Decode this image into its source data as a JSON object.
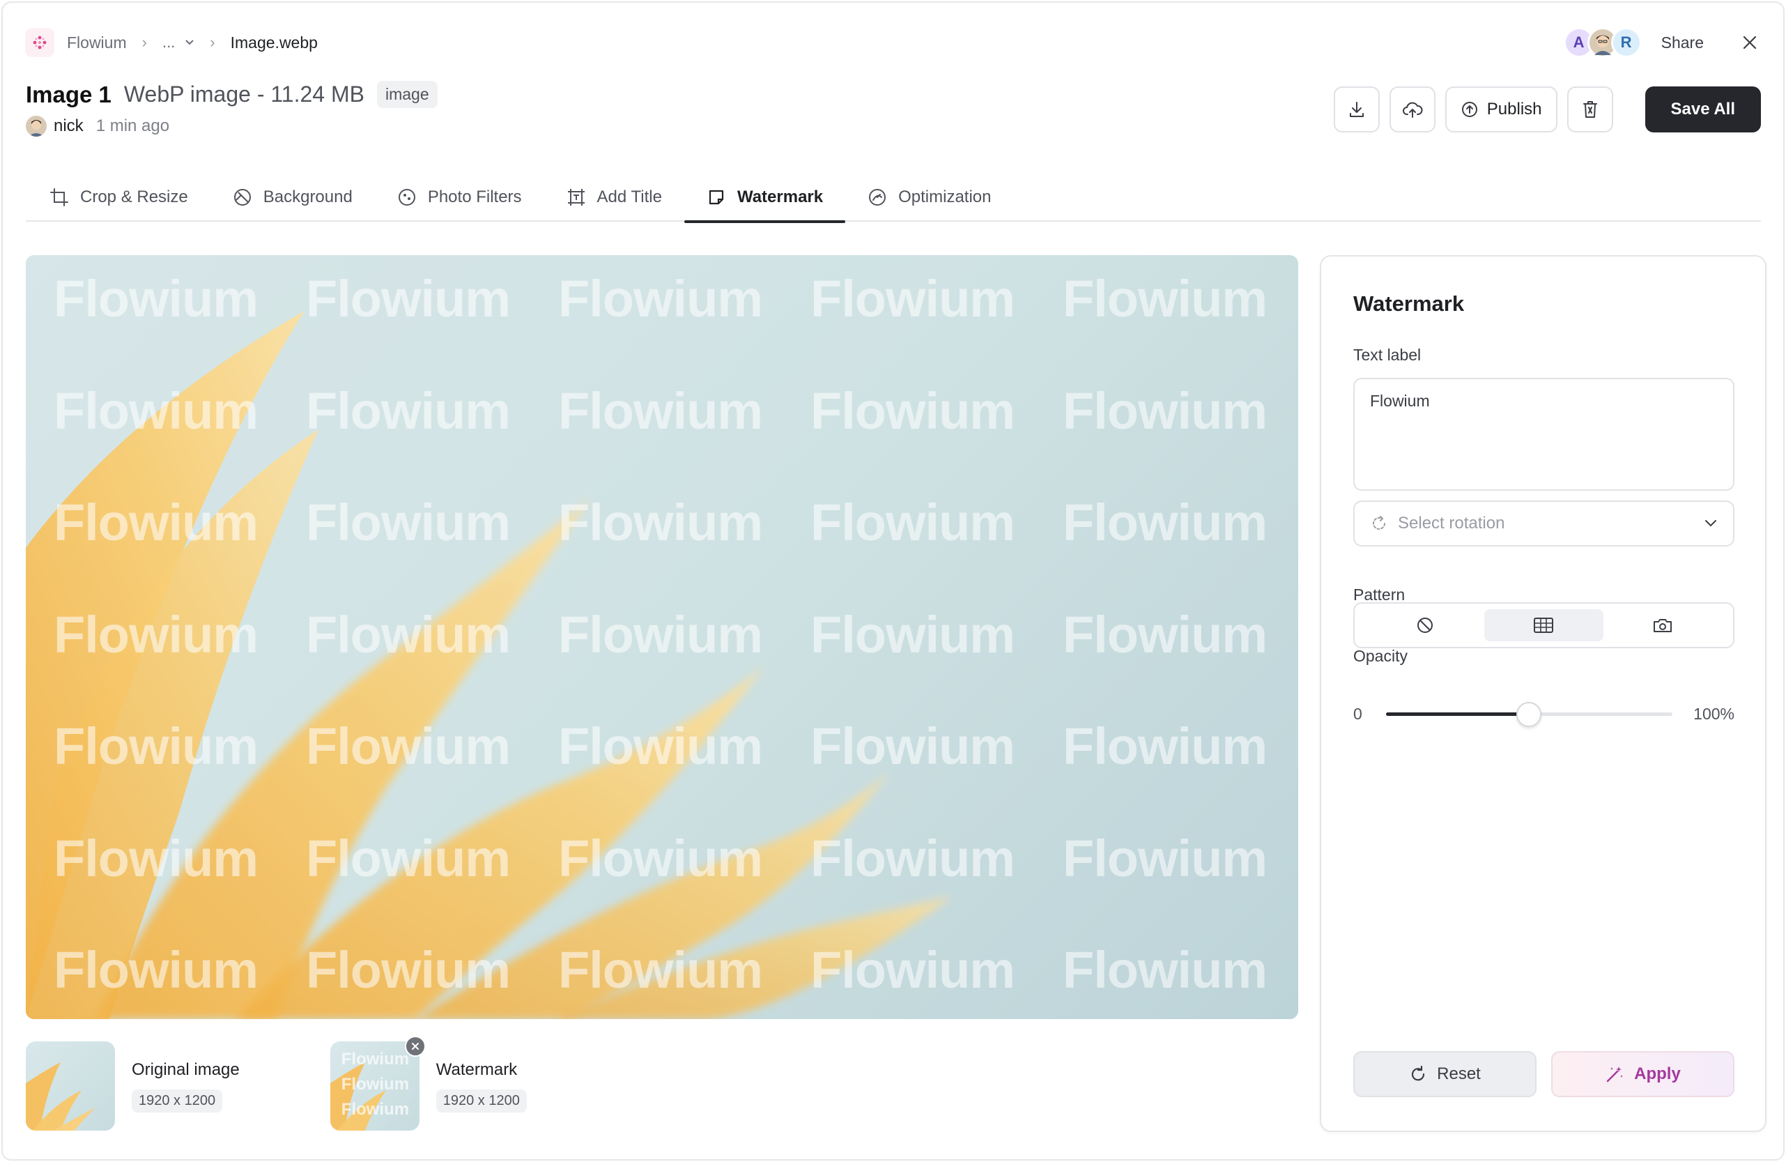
{
  "breadcrumb": {
    "app": "Flowium",
    "ellipsis": "...",
    "file": "Image.webp"
  },
  "header": {
    "avatars": [
      {
        "label": "A",
        "color": "#e6dcfb"
      },
      {
        "label": "",
        "color": "#d8c9b4"
      },
      {
        "label": "R",
        "color": "#dbeefb"
      }
    ],
    "share_label": "Share"
  },
  "file": {
    "title": "Image 1",
    "subtitle": "WebP image - 11.24 MB",
    "tag": "image",
    "user": "nick",
    "time": "1 min ago"
  },
  "actions": {
    "publish_label": "Publish",
    "save_all_label": "Save All"
  },
  "tabs": [
    {
      "label": "Crop & Resize",
      "icon": "crop-icon",
      "active": false
    },
    {
      "label": "Background",
      "icon": "background-icon",
      "active": false
    },
    {
      "label": "Photo Filters",
      "icon": "filter-icon",
      "active": false
    },
    {
      "label": "Add Title",
      "icon": "title-frame-icon",
      "active": false
    },
    {
      "label": "Watermark",
      "icon": "watermark-icon",
      "active": true
    },
    {
      "label": "Optimization",
      "icon": "gauge-icon",
      "active": false
    }
  ],
  "canvas": {
    "watermark_text": "Flowium",
    "rows": 7,
    "cols": 5
  },
  "thumbnails": [
    {
      "name": "Original image",
      "dimensions": "1920 x 1200"
    },
    {
      "name": "Watermark",
      "dimensions": "1920 x 1200",
      "overlay_lines": [
        "Flowium",
        "Flowium",
        "Flowium"
      ]
    }
  ],
  "panel": {
    "title": "Watermark",
    "text_label": "Text label",
    "text_value": "Flowium",
    "rotation_placeholder": "Select rotation",
    "pattern_label": "Pattern",
    "pattern_options": [
      "none-icon",
      "grid-icon",
      "camera-icon"
    ],
    "pattern_selected": 1,
    "opacity_label": "Opacity",
    "opacity_min": "0",
    "opacity_max": "100%",
    "opacity_value": 0.5,
    "reset_label": "Reset",
    "apply_label": "Apply"
  },
  "colors": {
    "accent_dark": "#25272c",
    "apply_text": "#a3399d",
    "border": "#e0e2e6"
  }
}
